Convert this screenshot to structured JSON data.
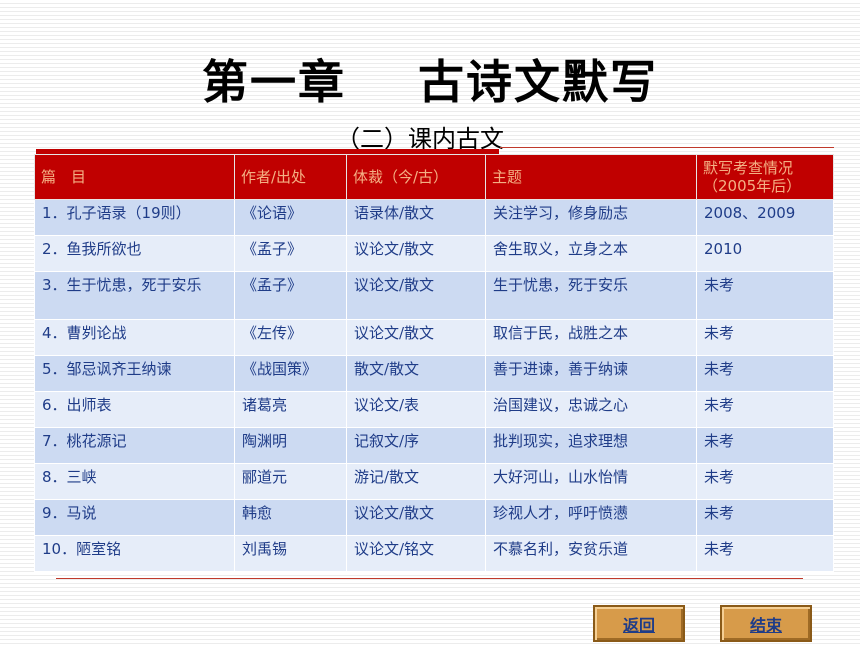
{
  "title": "第一章    古诗文默写",
  "subtitle": "（二）课内古文",
  "table": {
    "headers": [
      "篇　目",
      "作者/出处",
      "体裁（今/古）",
      "主题",
      "默写考查情况（2005年后）"
    ],
    "rows": [
      [
        "1．孔子语录（19则）",
        "《论语》",
        "语录体/散文",
        "关注学习，修身励志",
        "2008、2009"
      ],
      [
        "2．鱼我所欲也",
        "《孟子》",
        "议论文/散文",
        "舍生取义，立身之本",
        "2010"
      ],
      [
        "3．生于忧患，死于安乐",
        "《孟子》",
        "议论文/散文",
        "生于忧患，死于安乐",
        "未考"
      ],
      [
        "4．曹刿论战",
        "《左传》",
        "议论文/散文",
        "取信于民，战胜之本",
        "未考"
      ],
      [
        "5．邹忌讽齐王纳谏",
        "《战国策》",
        "散文/散文",
        "善于进谏，善于纳谏",
        "未考"
      ],
      [
        "6．出师表",
        "诸葛亮",
        "议论文/表",
        "治国建议，忠诚之心",
        "未考"
      ],
      [
        "7．桃花源记",
        "陶渊明",
        "记叙文/序",
        "批判现实，追求理想",
        "未考"
      ],
      [
        "8．三峡",
        "郦道元",
        "游记/散文",
        "大好河山，山水怡情",
        "未考"
      ],
      [
        "9．马说",
        "韩愈",
        "议论文/散文",
        "珍视人才，呼吁愤懑",
        "未考"
      ],
      [
        "10．陋室铭",
        "刘禹锡",
        "议论文/铭文",
        "不慕名利，安贫乐道",
        "未考"
      ]
    ]
  },
  "buttons": {
    "back": "返回",
    "end": "结束"
  }
}
